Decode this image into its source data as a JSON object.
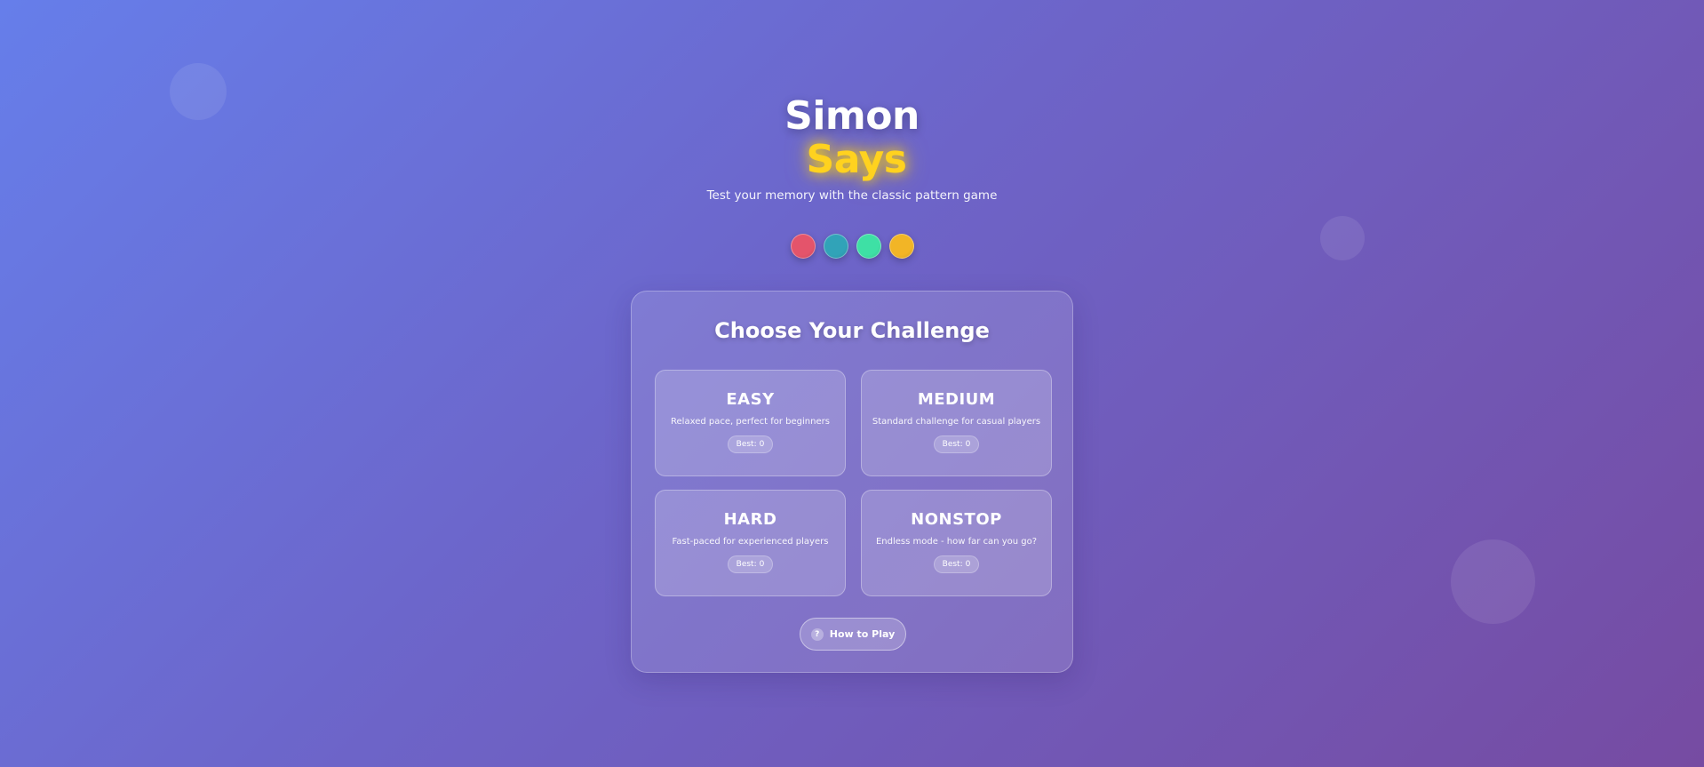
{
  "header": {
    "title_line1": "Simon",
    "title_line2": "Says",
    "subtitle": "Test your memory with the classic pattern game"
  },
  "color_dots": [
    {
      "name": "red",
      "color": "#e4546b"
    },
    {
      "name": "teal",
      "color": "#31a3b8"
    },
    {
      "name": "green",
      "color": "#3ee0a5"
    },
    {
      "name": "yellow",
      "color": "#f2b526"
    }
  ],
  "panel": {
    "title": "Choose Your Challenge",
    "modes": [
      {
        "name": "EASY",
        "description": "Relaxed pace, perfect for beginners",
        "best_label": "Best:",
        "best_value": "0"
      },
      {
        "name": "MEDIUM",
        "description": "Standard challenge for casual players",
        "best_label": "Best:",
        "best_value": "0"
      },
      {
        "name": "HARD",
        "description": "Fast-paced for experienced players",
        "best_label": "Best:",
        "best_value": "0"
      },
      {
        "name": "NONSTOP",
        "description": "Endless mode - how far can you go?",
        "best_label": "Best:",
        "best_value": "0"
      }
    ],
    "how_to_play": {
      "icon": "?",
      "label": "How to Play"
    }
  },
  "colors": {
    "accent_yellow": "#ffd21f",
    "background_start": "#667eea",
    "background_end": "#764ba2"
  }
}
